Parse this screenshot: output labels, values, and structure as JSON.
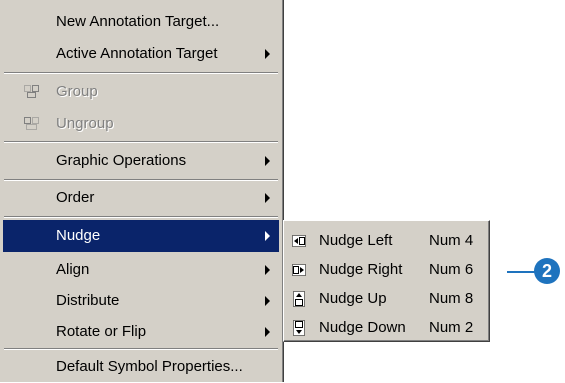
{
  "menu": {
    "items": [
      {
        "label": "New Annotation Target...",
        "enabled": true,
        "submenu": false
      },
      {
        "label": "Active Annotation Target",
        "enabled": true,
        "submenu": true
      },
      {
        "label": "Group",
        "enabled": false,
        "submenu": false,
        "icon": "group-icon"
      },
      {
        "label": "Ungroup",
        "enabled": false,
        "submenu": false,
        "icon": "ungroup-icon"
      },
      {
        "label": "Graphic Operations",
        "enabled": true,
        "submenu": true
      },
      {
        "label": "Order",
        "enabled": true,
        "submenu": true
      },
      {
        "label": "Nudge",
        "enabled": true,
        "submenu": true,
        "highlighted": true
      },
      {
        "label": "Align",
        "enabled": true,
        "submenu": true
      },
      {
        "label": "Distribute",
        "enabled": true,
        "submenu": true
      },
      {
        "label": "Rotate or Flip",
        "enabled": true,
        "submenu": true
      },
      {
        "label": "Default Symbol Properties...",
        "enabled": true,
        "submenu": false
      }
    ]
  },
  "nudge_submenu": {
    "items": [
      {
        "label": "Nudge Left",
        "shortcut": "Num 4",
        "icon": "nudge-left-icon"
      },
      {
        "label": "Nudge Right",
        "shortcut": "Num 6",
        "icon": "nudge-right-icon"
      },
      {
        "label": "Nudge Up",
        "shortcut": "Num 8",
        "icon": "nudge-up-icon"
      },
      {
        "label": "Nudge Down",
        "shortcut": "Num 2",
        "icon": "nudge-down-icon"
      }
    ]
  },
  "callout": {
    "number": "2",
    "color": "#1e73be"
  },
  "colors": {
    "menu_bg": "#d4d0c8",
    "highlight": "#0a246a"
  }
}
